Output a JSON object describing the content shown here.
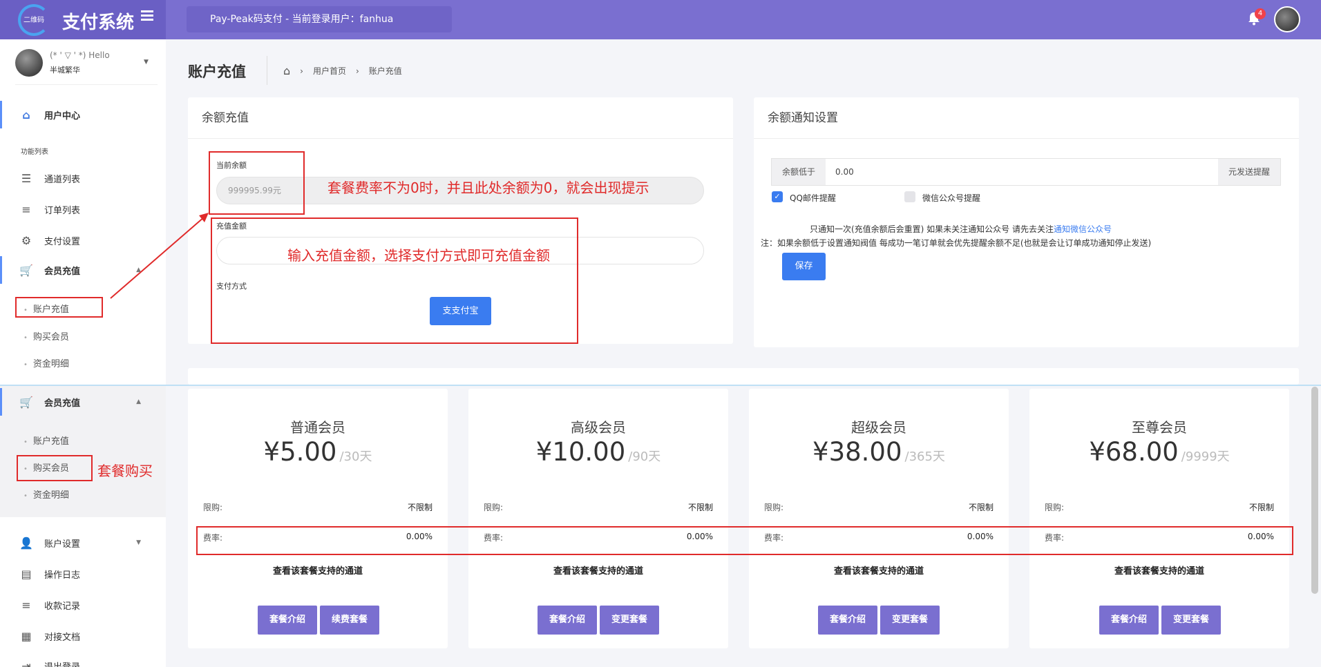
{
  "topbar": {
    "logo_small": "二维码",
    "logo_text": "支付系统",
    "title": "Pay-Peak码支付 - 当前登录用户：fanhua",
    "notification_count": "4"
  },
  "sidebar": {
    "user_hello": "(* ' ▽ ' *) Hello",
    "user_name": "半城繁华",
    "user_center": "用户中心",
    "section_label": "功能列表",
    "channel_list": "通道列表",
    "order_list": "订单列表",
    "pay_settings": "支付设置",
    "member_recharge": "会员充值",
    "sub_recharge": "账户充值",
    "sub_buy": "购买会员",
    "sub_funds": "资金明细",
    "lower": {
      "member_recharge": "会员充值",
      "sub_recharge": "账户充值",
      "sub_buy": "购买会员",
      "sub_funds": "资金明细"
    },
    "account_settings": "账户设置",
    "op_log": "操作日志",
    "receipts": "收款记录",
    "api_doc": "对接文档",
    "logout": "退出登录"
  },
  "page": {
    "title": "账户充值",
    "crumb_home": "用户首页",
    "crumb_current": "账户充值"
  },
  "recharge": {
    "card_title": "余额充值",
    "current_balance_label": "当前余额",
    "current_balance_value": "999995.99元",
    "amount_label": "充值金额",
    "pay_method_label": "支付方式",
    "alipay_button": "支付宝"
  },
  "annotations": {
    "note1": "套餐费率不为0时，并且此处余额为0，就会出现提示",
    "note2": "输入充值金额，选择支付方式即可充值金额",
    "note3": "套餐购买"
  },
  "notify": {
    "card_title": "余额通知设置",
    "prefix": "余额低于",
    "value": "0.00",
    "suffix": "元发送提醒",
    "qq_label": "QQ邮件提醒",
    "wechat_label": "微信公众号提醒",
    "line1_pre": "只通知一次(充值余额后会重置) 如果未关注通知公众号 请先去关注",
    "line1_link": "通知微信公众号",
    "line2": "注：如果余额低于设置通知阀值 每成功一笔订单就会优先提醒余额不足(也就是会让订单成功通知停止发送)",
    "save_button": "保存"
  },
  "plans": [
    {
      "name": "普通会员",
      "price": "¥5.00",
      "period": "/30天",
      "limit_label": "限购:",
      "limit_value": "不限制",
      "rate_label": "费率:",
      "rate_value": "0.00%",
      "channels_link": "查看该套餐支持的通道",
      "btn_intro": "套餐介绍",
      "btn_action": "续费套餐"
    },
    {
      "name": "高级会员",
      "price": "¥10.00",
      "period": "/90天",
      "limit_label": "限购:",
      "limit_value": "不限制",
      "rate_label": "费率:",
      "rate_value": "0.00%",
      "channels_link": "查看该套餐支持的通道",
      "btn_intro": "套餐介绍",
      "btn_action": "变更套餐"
    },
    {
      "name": "超级会员",
      "price": "¥38.00",
      "period": "/365天",
      "limit_label": "限购:",
      "limit_value": "不限制",
      "rate_label": "费率:",
      "rate_value": "0.00%",
      "channels_link": "查看该套餐支持的通道",
      "btn_intro": "套餐介绍",
      "btn_action": "变更套餐"
    },
    {
      "name": "至尊会员",
      "price": "¥68.00",
      "period": "/9999天",
      "limit_label": "限购:",
      "limit_value": "不限制",
      "rate_label": "费率:",
      "rate_value": "0.00%",
      "channels_link": "查看该套餐支持的通道",
      "btn_intro": "套餐介绍",
      "btn_action": "变更套餐"
    }
  ],
  "colors": {
    "topbar": "#7a6fd0",
    "primary_button": "#3a7cf0",
    "plan_button": "#7a6fd0",
    "annotation_red": "#e02a2a"
  }
}
